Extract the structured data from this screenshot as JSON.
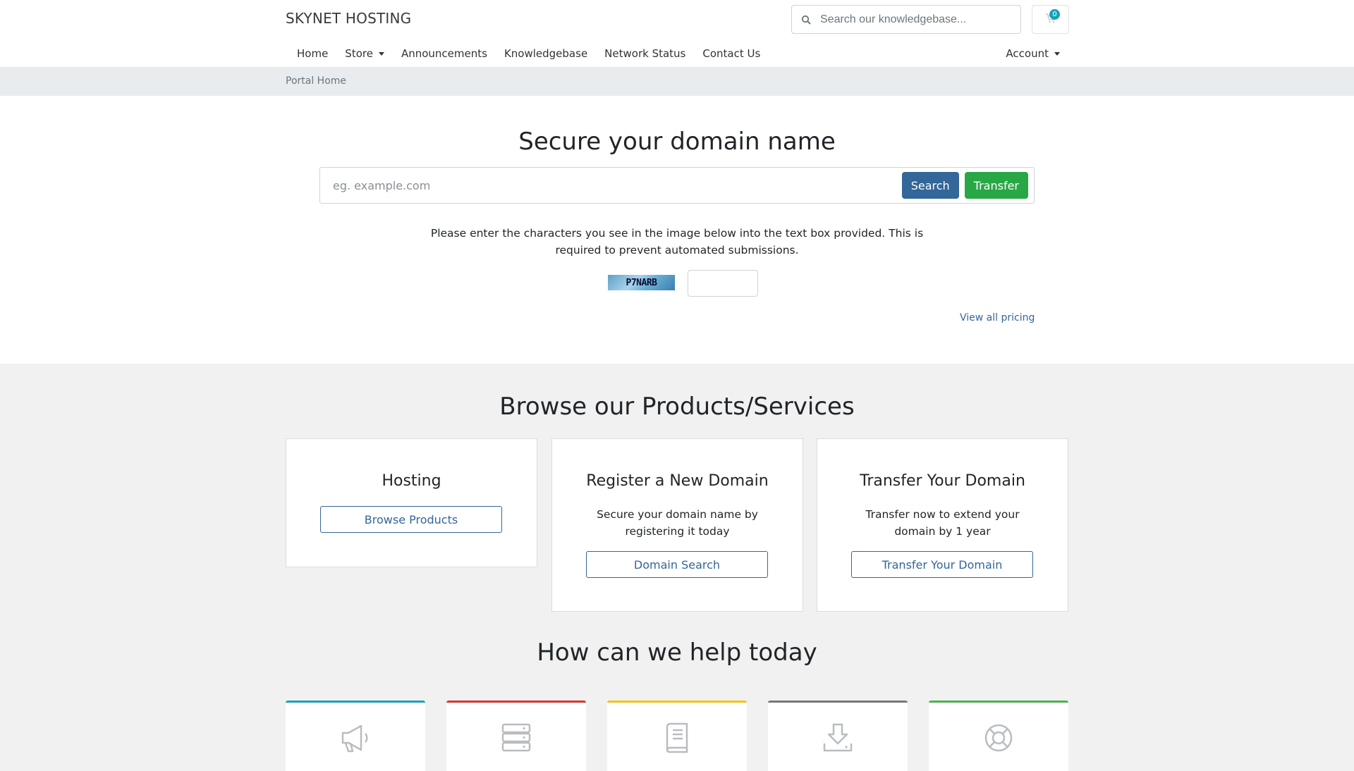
{
  "header": {
    "brand": "SKYNET HOSTING",
    "kb_search_placeholder": "Search our knowledgebase...",
    "cart_count": "0"
  },
  "nav": {
    "items": [
      "Home",
      "Store",
      "Announcements",
      "Knowledgebase",
      "Network Status",
      "Contact Us"
    ],
    "account": "Account"
  },
  "breadcrumb": "Portal Home",
  "domain": {
    "title": "Secure your domain name",
    "placeholder": "eg. example.com",
    "search_label": "Search",
    "transfer_label": "Transfer",
    "captcha_text": "Please enter the characters you see in the image below into the text box provided. This is required to prevent automated submissions.",
    "captcha_code": "P7NARB",
    "view_pricing": "View all pricing"
  },
  "products": {
    "title": "Browse our Products/Services",
    "cards": [
      {
        "title": "Hosting",
        "desc": "",
        "button": "Browse Products"
      },
      {
        "title": "Register a New Domain",
        "desc": "Secure your domain name by registering it today",
        "button": "Domain Search"
      },
      {
        "title": "Transfer Your Domain",
        "desc": "Transfer now to extend your domain by 1 year",
        "button": "Transfer Your Domain"
      }
    ]
  },
  "help": {
    "title": "How can we help today",
    "cards": [
      {
        "icon": "megaphone-icon",
        "color": "#17a2b8"
      },
      {
        "icon": "server-icon",
        "color": "#d9342b"
      },
      {
        "icon": "book-icon",
        "color": "#f5c216"
      },
      {
        "icon": "download-icon",
        "color": "#777777"
      },
      {
        "icon": "lifebuoy-icon",
        "color": "#4caf50"
      }
    ]
  }
}
